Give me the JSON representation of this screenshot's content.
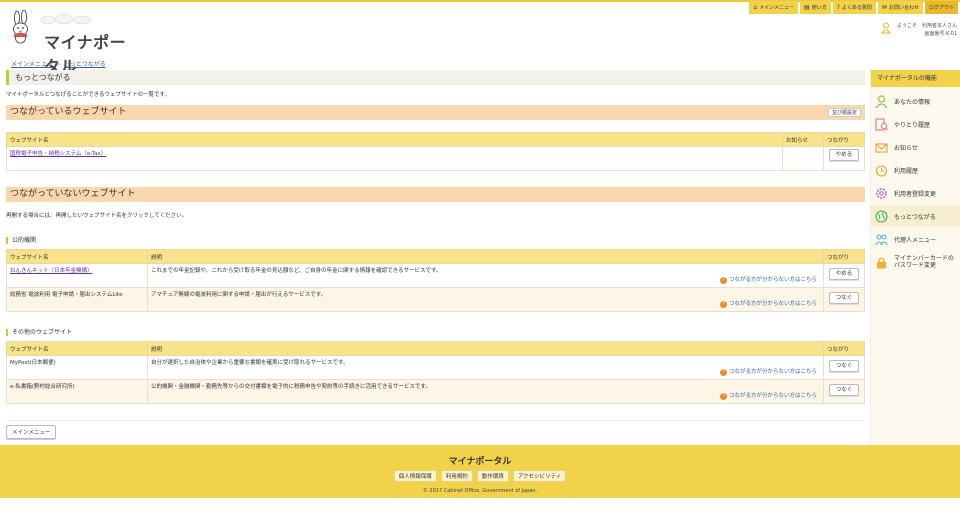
{
  "header": {
    "logo_text": "マイナポータル",
    "nav": [
      {
        "label": "メインメニュー",
        "icon": "home-icon"
      },
      {
        "label": "使い方",
        "icon": "book-icon"
      },
      {
        "label": "よくある質問",
        "icon": "question-icon"
      },
      {
        "label": "お問い合わせ",
        "icon": "chat-icon"
      },
      {
        "label": "ログアウト",
        "icon": ""
      }
    ],
    "welcome": "ようこそ　利用者本人さん",
    "screen_id": "画面番号:K-01"
  },
  "breadcrumb": [
    "メインメニュー",
    "もっとつながる"
  ],
  "page": {
    "title": "もっとつながる",
    "description": "マイナポータルとつなげることができるウェブサイトの一覧です。"
  },
  "connected": {
    "heading": "つながっているウェブサイト",
    "settings_button": "並び順設定",
    "columns": [
      "ウェブサイト名",
      "お知らせ",
      "つながり"
    ],
    "rows": [
      {
        "name": "国税電子申告・納税システム（e-Tax）",
        "notice": "",
        "action": "やめる"
      }
    ]
  },
  "unconnected": {
    "heading": "つながっていないウェブサイト",
    "note": "再開する場合には、再開したいウェブサイト名をクリックしてください。",
    "help_text": "つながる方が分からない方はこちら",
    "groups": [
      {
        "title": "公的機関",
        "columns": [
          "ウェブサイト名",
          "説明",
          "つながり"
        ],
        "rows": [
          {
            "name": "ねんきんネット（日本年金機構）",
            "link": true,
            "desc": "これまでの年金記録や、これから受け取る年金の見込額など、ご自身の年金に関する情報を確認できるサービスです。",
            "action": "やめる"
          },
          {
            "name": "総務省 電波利用 電子申請・届出システムLite",
            "link": false,
            "desc": "アマチュア無線の電波利用に関する申請・届出が行えるサービスです。",
            "action": "つなぐ"
          }
        ]
      },
      {
        "title": "その他のウェブサイト",
        "columns": [
          "ウェブサイト名",
          "説明",
          "つながり"
        ],
        "rows": [
          {
            "name": "MyPost(日本郵便)",
            "link": false,
            "desc": "自分が選択した自治体や企業から重要な書類を確実に受け取れるサービスです。",
            "action": "つなぐ"
          },
          {
            "name": "e-私書箱(野村総合研究所)",
            "link": false,
            "desc": "公的機関・金融機関・勤務先等からの交付書類を電子的に税務申告や契約等の手続きに活用できるサービスです。",
            "action": "つなぐ"
          }
        ]
      }
    ]
  },
  "main_menu_button": "メインメニュー",
  "sidebar": {
    "heading": "マイナポータルの機能",
    "items": [
      {
        "label": "あなたの情報",
        "icon": "person-icon",
        "color": "#8bc34a"
      },
      {
        "label": "やりとり履歴",
        "icon": "search-doc-icon",
        "color": "#e57373"
      },
      {
        "label": "お知らせ",
        "icon": "mail-icon",
        "color": "#f0a030"
      },
      {
        "label": "利用履歴",
        "icon": "clock-icon",
        "color": "#f0a030"
      },
      {
        "label": "利用者登録変更",
        "icon": "gear-icon",
        "color": "#b06ab3"
      },
      {
        "label": "もっとつながる",
        "icon": "globe-icon",
        "color": "#4caf50"
      },
      {
        "label": "代理人メニュー",
        "icon": "people-icon",
        "color": "#4ab0c8"
      },
      {
        "label": "マイナンバーカードの",
        "label2": "パスワード変更",
        "icon": "lock-icon",
        "color": "#f0b020"
      }
    ]
  },
  "footer": {
    "title": "マイナポータル",
    "links": [
      "個人情報保護",
      "利用規約",
      "動作環境",
      "アクセシビリティ"
    ],
    "copyright": "© 2017 Cabinet Office, Government of Japan."
  }
}
